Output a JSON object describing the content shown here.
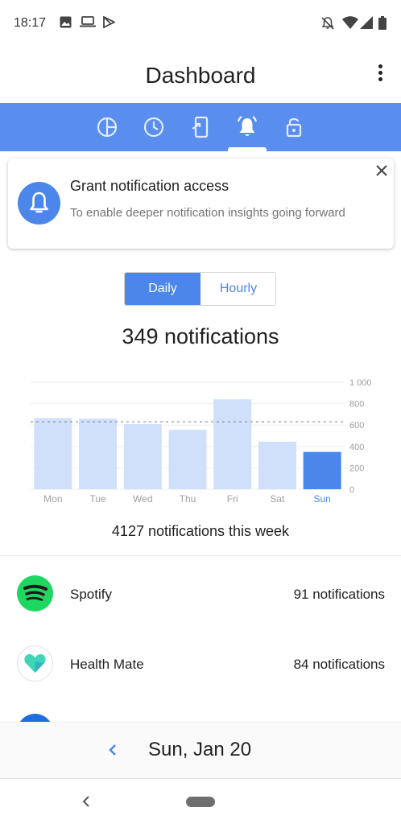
{
  "status_bar": {
    "time": "18:17",
    "icons_left": [
      "image-icon",
      "laptop-icon",
      "play-store-icon"
    ],
    "icons_right": [
      "notifications-off-icon",
      "wifi-icon",
      "signal-icon",
      "battery-icon"
    ]
  },
  "header": {
    "title": "Dashboard",
    "menu_icon": "more-vertical-icon"
  },
  "tabs": [
    {
      "icon": "pie-chart-icon",
      "selected": false
    },
    {
      "icon": "clock-icon",
      "selected": false
    },
    {
      "icon": "phone-unlock-icon",
      "selected": false
    },
    {
      "icon": "bell-icon",
      "selected": true
    },
    {
      "icon": "lock-icon",
      "selected": false
    }
  ],
  "card": {
    "title": "Grant notification access",
    "text": "To enable deeper notification insights going forward",
    "icon": "bell-icon",
    "close_icon": "close-icon"
  },
  "toggle": {
    "daily": "Daily",
    "hourly": "Hourly",
    "selected": "Daily"
  },
  "summary": {
    "total": "349 notifications",
    "week_total": "4127 notifications this week"
  },
  "chart_data": {
    "type": "bar",
    "categories": [
      "Mon",
      "Tue",
      "Wed",
      "Thu",
      "Fri",
      "Sat",
      "Sun"
    ],
    "values": [
      665,
      660,
      610,
      555,
      840,
      445,
      349
    ],
    "selected_index": 6,
    "average": 630,
    "ylim": [
      0,
      1000
    ],
    "yticks": [
      "1 000",
      "800",
      "600",
      "400",
      "200",
      "0"
    ],
    "grid": true,
    "colors": {
      "bar": "#d0e0fb",
      "selected_bar": "#4b86ea",
      "average_line": "#888888"
    }
  },
  "apps": [
    {
      "name": "Spotify",
      "count": "91 notifications",
      "icon": "spotify-icon",
      "color": "#1ed760"
    },
    {
      "name": "Health Mate",
      "count": "84 notifications",
      "icon": "health-mate-icon",
      "color": "#3fd5b6"
    }
  ],
  "date_bar": {
    "date": "Sun, Jan 20",
    "prev_icon": "chevron-left-icon"
  },
  "colors": {
    "accent": "#4b86ea",
    "tab_bar": "#5a8eee"
  }
}
